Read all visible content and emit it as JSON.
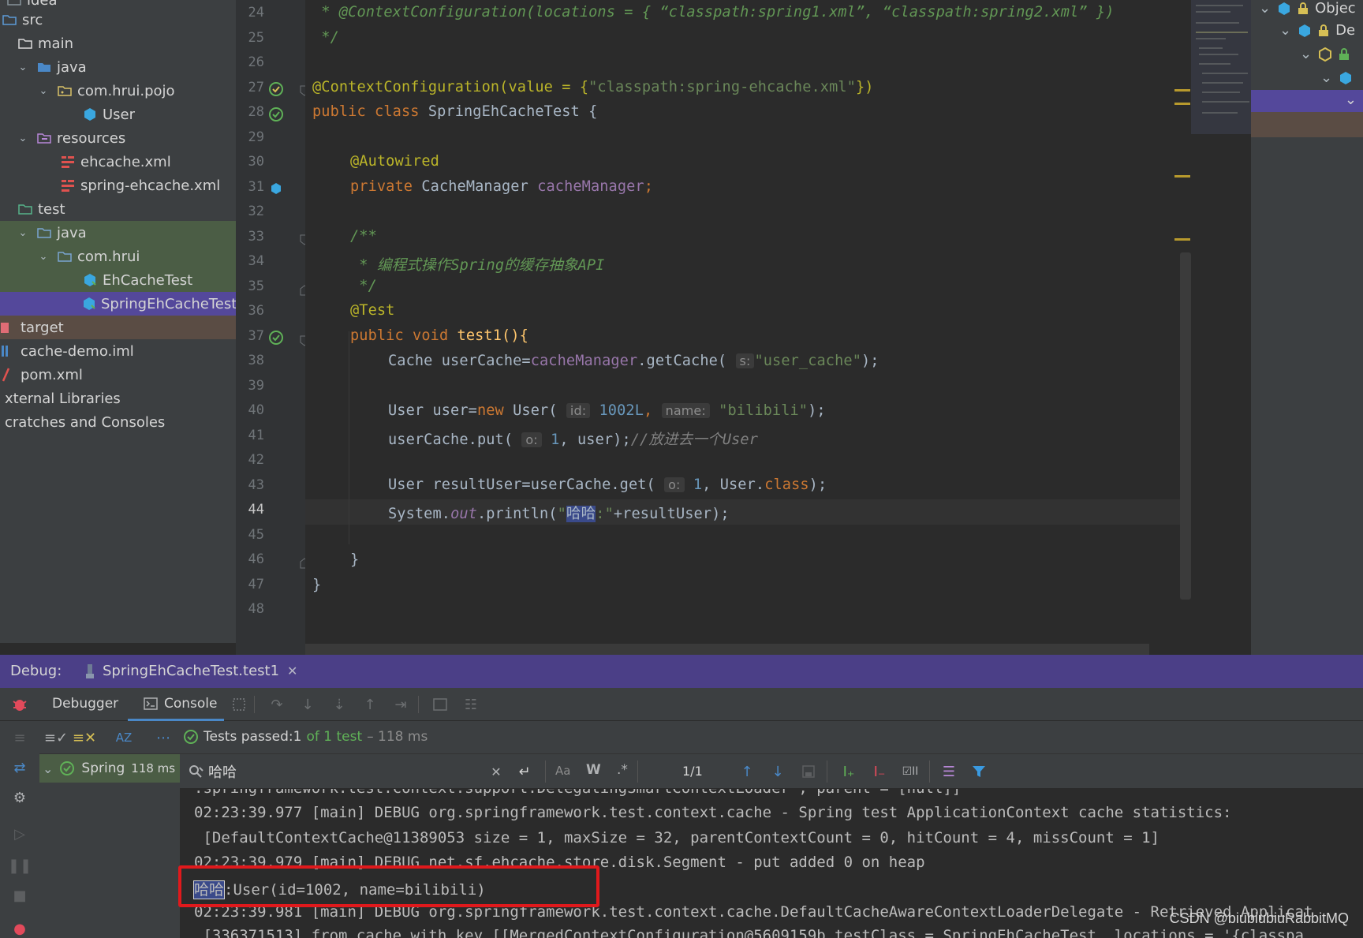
{
  "project_tree": {
    "items": [
      {
        "label": "idea"
      },
      {
        "label": "src"
      },
      {
        "label": "main"
      },
      {
        "label": "java"
      },
      {
        "label": "com.hrui.pojo"
      },
      {
        "label": "User"
      },
      {
        "label": "resources"
      },
      {
        "label": "ehcache.xml"
      },
      {
        "label": "spring-ehcache.xml"
      },
      {
        "label": "test"
      },
      {
        "label": "java"
      },
      {
        "label": "com.hrui"
      },
      {
        "label": "EhCacheTest"
      },
      {
        "label": "SpringEhCacheTest"
      },
      {
        "label": "target"
      },
      {
        "label": "cache-demo.iml"
      },
      {
        "label": "pom.xml"
      },
      {
        "label": "xternal Libraries"
      },
      {
        "label": "cratches and Consoles"
      }
    ]
  },
  "editor": {
    "line_numbers": [
      "24",
      "25",
      "26",
      "27",
      "28",
      "29",
      "30",
      "31",
      "32",
      "33",
      "34",
      "35",
      "36",
      "37",
      "38",
      "39",
      "40",
      "41",
      "42",
      "43",
      "44",
      "45",
      "46",
      "47",
      "48"
    ],
    "current_line": "44",
    "code": {
      "l24_comment": " * @ContextConfiguration(locations = { “classpath:spring1.xml”, “classpath:spring2.xml” })",
      "l25": " */",
      "l27_ann": "@ContextConfiguration(value = {",
      "l27_str": "\"classpath:spring-ehcache.xml\"",
      "l27_end": "})",
      "l28_kw": "public class ",
      "l28_name": "SpringEhCacheTest {",
      "l30": "@Autowired",
      "l31_kw": "private ",
      "l31_type": "CacheManager ",
      "l31_field": "cacheManager",
      "l31_end": ";",
      "l33": "/**",
      "l34": " * 编程式操作Spring的缓存抽象API",
      "l35": " */",
      "l36": "@Test",
      "l37_kw": "public void ",
      "l37_name": "test1(){",
      "l38_a": "Cache userCache=",
      "l38_field": "cacheManager",
      "l38_b": ".getCache(",
      "l38_hint": "s:",
      "l38_str": "\"user_cache\"",
      "l38_end": ");",
      "l40_a": "User user=",
      "l40_kw": "new ",
      "l40_b": "User(",
      "l40_hint1": "id:",
      "l40_num": "1002L",
      "l40_c": ", ",
      "l40_hint2": "name:",
      "l40_str": "\"bilibili\"",
      "l40_end": ");",
      "l41_a": "userCache.put(",
      "l41_hint": "o:",
      "l41_num": "1",
      "l41_b": ", user);",
      "l41_cmt": "//放进去一个User",
      "l43_a": "User resultUser=userCache.get(",
      "l43_hint": "o:",
      "l43_num": "1",
      "l43_b": ", User.",
      "l43_kw": "class",
      "l43_end": ");",
      "l44_a": "System.",
      "l44_out": "out",
      "l44_b": ".println(",
      "l44_str1": "\"",
      "l44_find": "哈哈",
      "l44_str2": ":\"",
      "l44_c": "+resultUser);",
      "l46": "}",
      "l47": "}"
    }
  },
  "right_panel": {
    "items": [
      "Objec",
      "De"
    ]
  },
  "debug": {
    "label": "Debug:",
    "tab": "SpringEhCacheTest.test1",
    "tabs": [
      "Debugger",
      "Console"
    ],
    "status_prefix": "Tests passed: ",
    "status_count": "1",
    "status_of": " of 1 test",
    "status_time": " – 118 ms",
    "tree_item": "Spring",
    "tree_time": "118 ms"
  },
  "search": {
    "query": "哈哈",
    "match_count": "1/1",
    "opt_case": "Aa",
    "opt_words": "W",
    "opt_regex": ".*"
  },
  "console": {
    "lines": [
      ".springframework.test.context.support.DelegatingSmartContextLoader', parent = [null]]",
      "02:23:39.977 [main] DEBUG org.springframework.test.context.cache - Spring test ApplicationContext cache statistics:",
      " [DefaultContextCache@11389053 size = 1, maxSize = 32, parentContextCount = 0, hitCount = 4, missCount = 1]",
      "02:23:39.979 [main] DEBUG net.sf.ehcache.store.disk.Segment - put added 0 on heap",
      "",
      "02:23:39.981 [main] DEBUG org.springframework.test.context.cache.DefaultCacheAwareContextLoaderDelegate - Retrieved Applicat",
      " [336371513] from cache with key [[MergedContextConfiguration@5609159b testClass = SpringEhCacheTest, locations = '{classpa"
    ],
    "highlight_match": "哈哈",
    "highlight_rest": ":User(id=1002, name=bilibili)"
  },
  "watermark": "CSDN @biubiubiuRabbitMQ",
  "colors": {
    "accent": "#4b3f87",
    "annotation_box": "#e0191c",
    "pass_green": "#5fb157"
  }
}
